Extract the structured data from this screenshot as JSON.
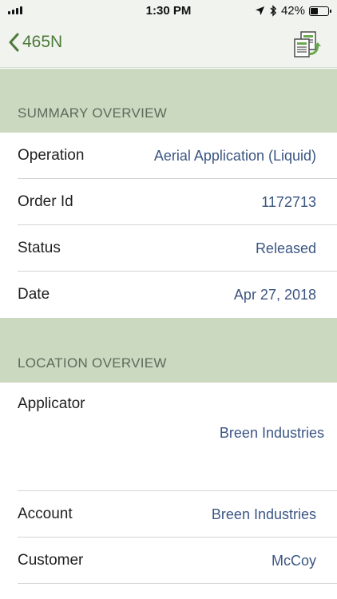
{
  "status_bar": {
    "time": "1:30 PM",
    "battery_percent_label": "42%",
    "battery_level": 0.42,
    "icons": [
      "signal-icon",
      "location-arrow-icon",
      "bluetooth-icon",
      "battery-icon"
    ]
  },
  "nav": {
    "back_label": "465N",
    "back_icon": "chevron-left-icon",
    "action_icon": "report-document-icon"
  },
  "summary": {
    "header": "SUMMARY OVERVIEW",
    "rows": [
      {
        "label": "Operation",
        "value": "Aerial Application (Liquid)"
      },
      {
        "label": "Order Id",
        "value": "1172713"
      },
      {
        "label": "Status",
        "value": "Released"
      },
      {
        "label": "Date",
        "value": "Apr 27, 2018"
      }
    ]
  },
  "location": {
    "header": "LOCATION OVERVIEW",
    "rows": [
      {
        "label": "Applicator",
        "value": "Breen Industries"
      },
      {
        "label": "Account",
        "value": "Breen Industries"
      },
      {
        "label": "Customer",
        "value": "McCoy"
      }
    ]
  },
  "colors": {
    "accent_green": "#4d7a3a",
    "section_header_bg": "#ccd9c1",
    "value_blue": "#3b5583"
  }
}
